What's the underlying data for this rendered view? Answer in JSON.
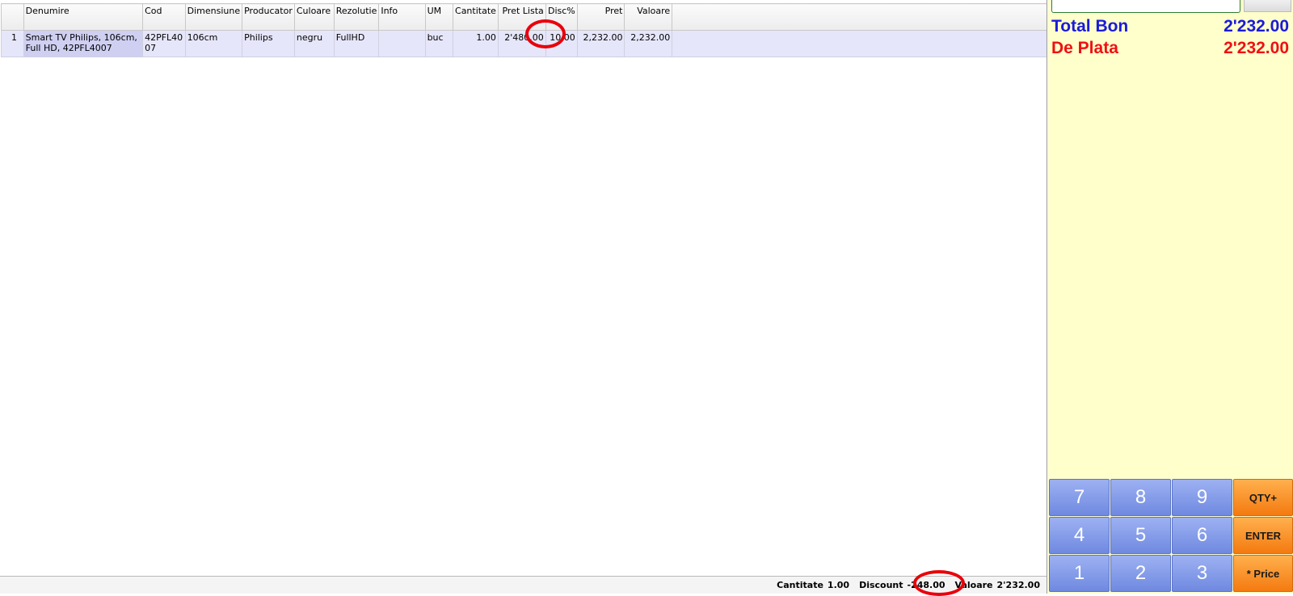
{
  "grid": {
    "columns": [
      "Denumire",
      "Cod",
      "Dimensiune",
      "Producator",
      "Culoare",
      "Rezolutie",
      "Info",
      "UM",
      "Cantitate",
      "Pret Lista",
      "Disc%",
      "Pret",
      "Valoare"
    ],
    "rows": [
      {
        "nr": "1",
        "denumire": "Smart TV Philips, 106cm, Full HD, 42PFL4007",
        "cod": "42PFL4007",
        "dimensiune": "106cm",
        "producator": "Philips",
        "culoare": "negru",
        "rezolutie": "FullHD",
        "info": "",
        "um": "buc",
        "cantitate": "1.00",
        "pret_lista": "2'480.00",
        "disc": "10.00",
        "pret": "2,232.00",
        "valoare": "2,232.00"
      }
    ]
  },
  "footer": {
    "cantitate_label": "Cantitate",
    "cantitate_value": "1.00",
    "discount_label": "Discount",
    "discount_value": "-248.00",
    "valoare_label": "Valoare",
    "valoare_value": "2'232.00"
  },
  "summary": {
    "total_bon_label": "Total Bon",
    "total_bon_value": "2'232.00",
    "de_plata_label": "De Plata",
    "de_plata_value": "2'232.00"
  },
  "keypad": {
    "keys": [
      "7",
      "8",
      "9",
      "QTY+",
      "4",
      "5",
      "6",
      "ENTER",
      "1",
      "2",
      "3",
      "* Price"
    ]
  },
  "colors": {
    "total_bon": "#1a1adb",
    "de_plata": "#ee1111",
    "panel_bg": "#ffffcc",
    "numeric_key": "#7f98e6",
    "function_key": "#f7901f",
    "highlight_circle": "#e8000b"
  }
}
